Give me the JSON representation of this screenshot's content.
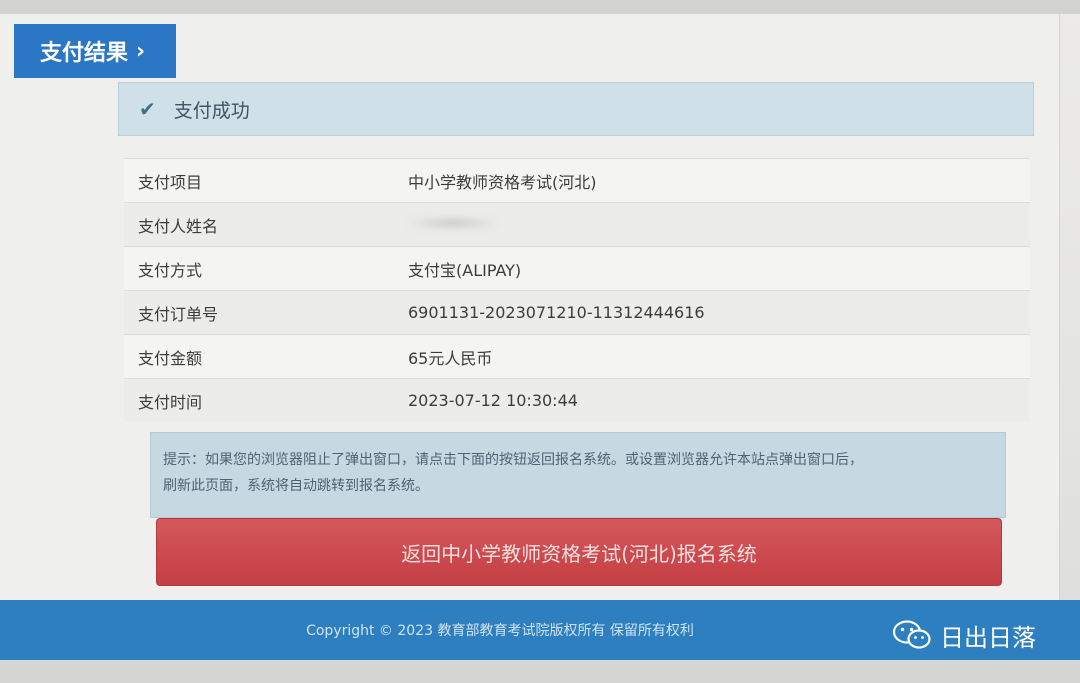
{
  "header": {
    "title": "支付结果",
    "chevron": "›"
  },
  "status": {
    "icon": "check-icon",
    "text": "支付成功"
  },
  "details": [
    {
      "label": "支付项目",
      "value": "中小学教师资格考试(河北)"
    },
    {
      "label": "支付人姓名",
      "value": ""
    },
    {
      "label": "支付方式",
      "value": "支付宝(ALIPAY)"
    },
    {
      "label": "支付订单号",
      "value": "6901131-2023071210-11312444616"
    },
    {
      "label": "支付金额",
      "value": "65元人民币"
    },
    {
      "label": "支付时间",
      "value": "2023-07-12 10:30:44"
    }
  ],
  "tip": {
    "line1": "提示：如果您的浏览器阻止了弹出窗口，请点击下面的按钮返回报名系统。或设置浏览器允许本站点弹出窗口后，",
    "line2": "刷新此页面，系统将自动跳转到报名系统。"
  },
  "return_button": {
    "label": "返回中小学教师资格考试(河北)报名系统"
  },
  "footer": {
    "copyright": "Copyright © 2023 教育部教育考试院版权所有 保留所有权利"
  },
  "watermark": {
    "text": "日出日落",
    "icon": "wechat-icon"
  },
  "colors": {
    "tab_blue": "#2c76c6",
    "status_bg": "#cfe0e8",
    "button_red": "#c43f44",
    "footer_blue": "#2e7fbf"
  }
}
